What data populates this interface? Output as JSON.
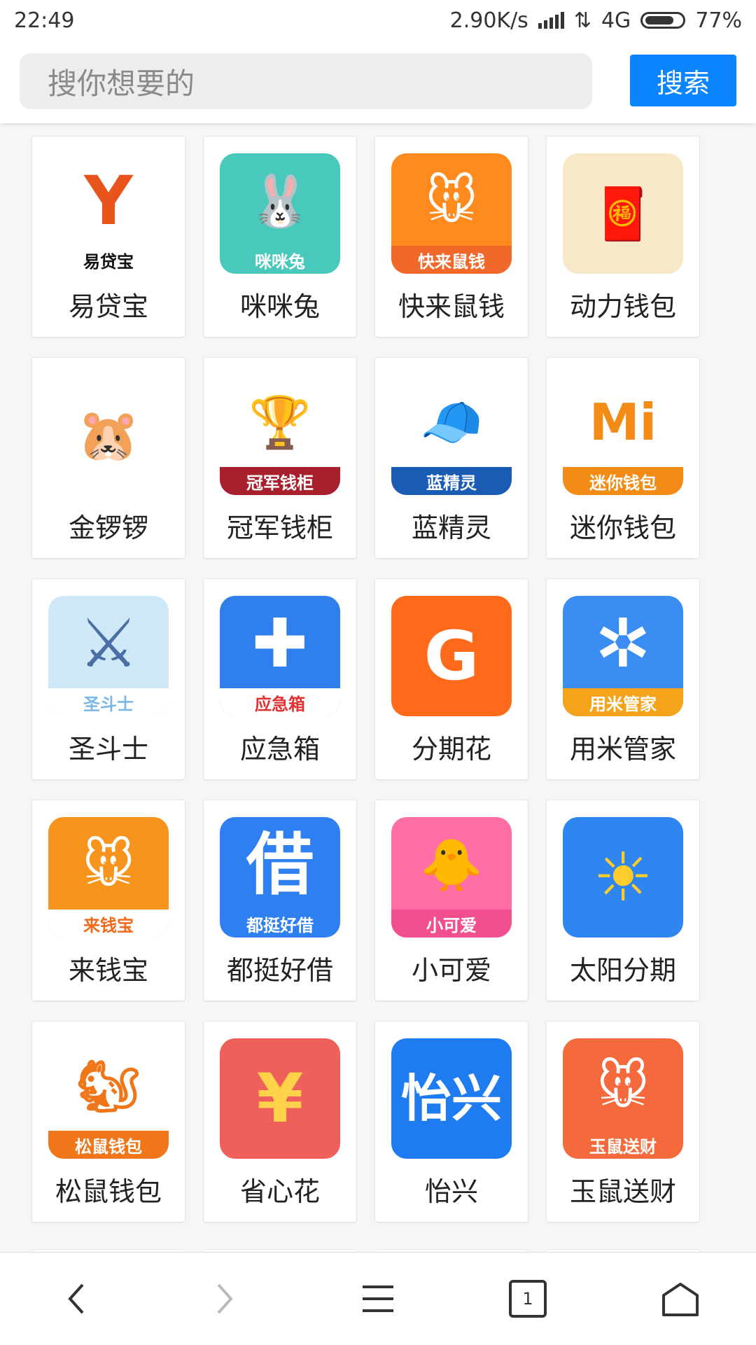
{
  "status_bar": {
    "time": "22:49",
    "net_speed": "2.90K/s",
    "network": "4G",
    "battery": "77%",
    "battery_level": 0.77
  },
  "search": {
    "placeholder": "搜你想要的",
    "button_label": "搜索"
  },
  "apps": [
    {
      "label": "易贷宝",
      "caption": "易贷宝",
      "glyph": "Y",
      "icon_name": "yidaibao-app-icon",
      "bg": "#ffffff",
      "fg": "#e8541c",
      "cap_fg": "#111111",
      "cap_bg": "transparent"
    },
    {
      "label": "咪咪兔",
      "caption": "咪咪兔",
      "glyph": "🐰",
      "icon_name": "mimitu-app-icon",
      "bg": "#49c8bc",
      "fg": "#ffffff",
      "cap_fg": "#ffffff",
      "cap_bg": "transparent"
    },
    {
      "label": "快来鼠钱",
      "caption": "快来鼠钱",
      "glyph": "🐭",
      "icon_name": "kuailaishuqian-app-icon",
      "bg": "#ff8a1e",
      "fg": "#ffffff",
      "cap_fg": "#ffffff",
      "cap_bg": "#f0682a"
    },
    {
      "label": "动力钱包",
      "caption": "",
      "glyph": "🧧",
      "icon_name": "dongliqianbao-app-icon",
      "bg": "#f7e9c8",
      "fg": "#d6283a",
      "cap_fg": "#ffffff",
      "cap_bg": "transparent"
    },
    {
      "label": "金锣锣",
      "caption": "",
      "glyph": "🐹",
      "icon_name": "jinluoluo-app-icon",
      "bg": "#ffffff",
      "fg": "#f2a51c",
      "cap_fg": "#ffffff",
      "cap_bg": "transparent"
    },
    {
      "label": "冠军钱柜",
      "caption": "冠军钱柜",
      "glyph": "🏆",
      "icon_name": "guanjunqiangui-app-icon",
      "bg": "#ffffff",
      "fg": "#e4a81a",
      "cap_fg": "#ffffff",
      "cap_bg": "#a8202e"
    },
    {
      "label": "蓝精灵",
      "caption": "蓝精灵",
      "glyph": "🧢",
      "icon_name": "lanjingling-app-icon",
      "bg": "#ffffff",
      "fg": "#2b6fc4",
      "cap_fg": "#ffffff",
      "cap_bg": "#1a5bb3"
    },
    {
      "label": "迷你钱包",
      "caption": "迷你钱包",
      "glyph": "Mi",
      "icon_name": "miniqianbao-app-icon",
      "bg": "#ffffff",
      "fg": "#f28c16",
      "cap_fg": "#ffffff",
      "cap_bg": "#f28c16"
    },
    {
      "label": "圣斗士",
      "caption": "圣斗士",
      "glyph": "⚔",
      "icon_name": "shengdoushi-app-icon",
      "bg": "#cfe8f7",
      "fg": "#4a6fa5",
      "cap_fg": "#7bb8e6",
      "cap_bg": "#ffffff"
    },
    {
      "label": "应急箱",
      "caption": "应急箱",
      "glyph": "✚",
      "icon_name": "yingjixiang-app-icon",
      "bg": "#2f80ed",
      "fg": "#ffffff",
      "cap_fg": "#e03030",
      "cap_bg": "#ffffff"
    },
    {
      "label": "分期花",
      "caption": "",
      "glyph": "G",
      "icon_name": "fenqihua-app-icon",
      "bg": "#ff6a1a",
      "fg": "#ffffff",
      "cap_fg": "#ffffff",
      "cap_bg": "transparent"
    },
    {
      "label": "用米管家",
      "caption": "用米管家",
      "glyph": "✲",
      "icon_name": "yongmiguanjia-app-icon",
      "bg": "#3b8df2",
      "fg": "#ffffff",
      "cap_fg": "#ffffff",
      "cap_bg": "#f5a31a"
    },
    {
      "label": "来钱宝",
      "caption": "来钱宝",
      "glyph": "🐭",
      "icon_name": "laiqianbao-app-icon",
      "bg": "#f7941d",
      "fg": "#ffffff",
      "cap_fg": "#f06a1a",
      "cap_bg": "#ffffff"
    },
    {
      "label": "都挺好借",
      "caption": "都挺好借",
      "glyph": "借",
      "icon_name": "doutinghaojie-app-icon",
      "bg": "#2e7ff0",
      "fg": "#ffffff",
      "cap_fg": "#ffffff",
      "cap_bg": "transparent"
    },
    {
      "label": "小可爱",
      "caption": "小可爱",
      "glyph": "🐥",
      "icon_name": "xiaokeai-app-icon",
      "bg": "#ff6fa5",
      "fg": "#ffffff",
      "cap_fg": "#ffffff",
      "cap_bg": "#f24f8f"
    },
    {
      "label": "太阳分期",
      "caption": "",
      "glyph": "☀",
      "icon_name": "taiyangfenqi-app-icon",
      "bg": "#2f86f0",
      "fg": "#ffcc2e",
      "cap_fg": "#ffffff",
      "cap_bg": "transparent"
    },
    {
      "label": "松鼠钱包",
      "caption": "松鼠钱包",
      "glyph": "🐿",
      "icon_name": "songshuqianbao-app-icon",
      "bg": "#ffffff",
      "fg": "#f0761a",
      "cap_fg": "#ffffff",
      "cap_bg": "#f0761a"
    },
    {
      "label": "省心花",
      "caption": "",
      "glyph": "¥",
      "icon_name": "shengxinhua-app-icon",
      "bg": "#f0605a",
      "fg": "#ffd24a",
      "cap_fg": "#ffffff",
      "cap_bg": "transparent"
    },
    {
      "label": "怡兴",
      "caption": "",
      "glyph": "怡兴",
      "icon_name": "yixing-app-icon",
      "bg": "#1f7cf0",
      "fg": "#ffffff",
      "cap_fg": "#ffffff",
      "cap_bg": "transparent"
    },
    {
      "label": "玉鼠送财",
      "caption": "玉鼠送财",
      "glyph": "🐭",
      "icon_name": "yushusongcai-app-icon",
      "bg": "#f46a3c",
      "fg": "#ffffff",
      "cap_fg": "#ffffff",
      "cap_bg": "transparent"
    }
  ],
  "bottom_nav": {
    "back_icon": "back-arrow-icon",
    "forward_icon": "forward-arrow-icon",
    "menu_icon": "menu-icon",
    "tab_count": "1",
    "home_icon": "home-icon"
  }
}
